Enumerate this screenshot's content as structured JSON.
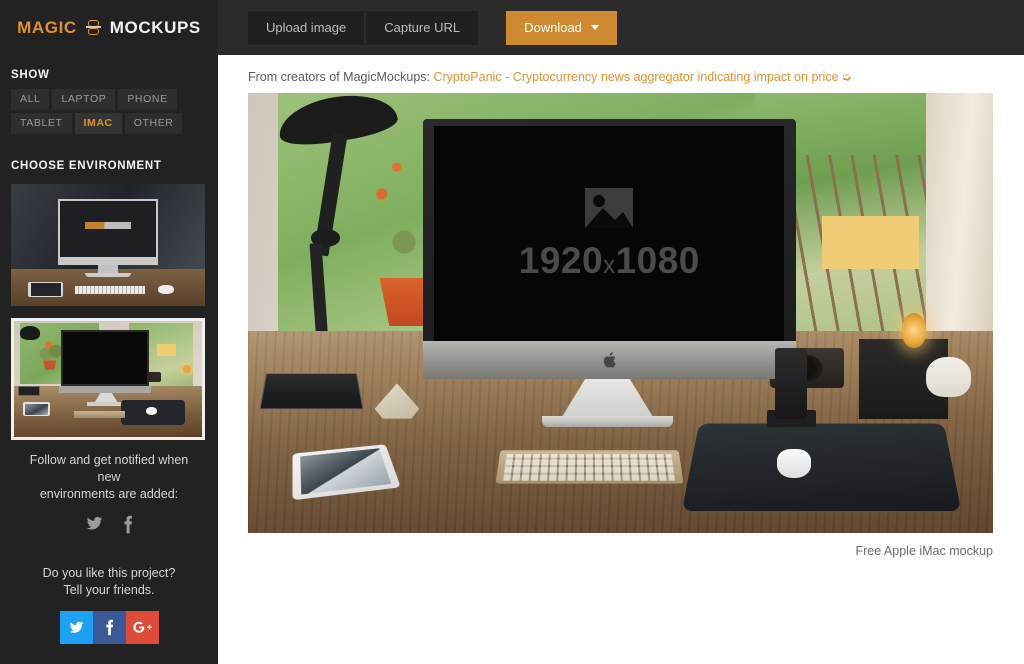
{
  "brand": {
    "name_first": "MAGIC",
    "name_second": "MOCKUPS",
    "mark_icon": "magic-mockups-mark-icon"
  },
  "toolbar": {
    "upload_label": "Upload image",
    "capture_label": "Capture URL",
    "download_label": "Download",
    "download_caret_icon": "chevron-down-icon",
    "accent_color": "#cd8a31"
  },
  "promo": {
    "prefix": "From creators of MagicMockups:",
    "link_text": "CryptoPanic - Cryptocurrency news aggregator indicating impact on price",
    "external_icon": "external-link-arrow-icon",
    "link_color": "#e0912f"
  },
  "sidebar": {
    "show": {
      "heading": "SHOW",
      "filters": [
        {
          "label": "ALL",
          "active": false
        },
        {
          "label": "LAPTOP",
          "active": false
        },
        {
          "label": "PHONE",
          "active": false
        },
        {
          "label": "TABLET",
          "active": false
        },
        {
          "label": "IMAC",
          "active": true
        },
        {
          "label": "OTHER",
          "active": false
        }
      ]
    },
    "environment": {
      "heading": "CHOOSE ENVIRONMENT",
      "items": [
        {
          "name": "dark-imac-desk-environment",
          "selected": false
        },
        {
          "name": "window-imac-desk-environment",
          "selected": true
        }
      ]
    },
    "follow": {
      "text_line1": "Follow and get notified when new",
      "text_line2": "environments are added:",
      "icons": [
        {
          "name": "twitter-icon",
          "label": "Twitter"
        },
        {
          "name": "facebook-icon",
          "label": "Facebook"
        }
      ]
    },
    "share": {
      "text_line1": "Do you like this project?",
      "text_line2": "Tell your friends.",
      "buttons": [
        {
          "name": "twitter-share-button",
          "label": "Twitter",
          "color": "#1DA1F2"
        },
        {
          "name": "facebook-share-button",
          "label": "Facebook",
          "color": "#3B5998"
        },
        {
          "name": "googleplus-share-button",
          "label": "Google Plus",
          "color": "#DD4B39"
        }
      ]
    }
  },
  "preview": {
    "placeholder": {
      "icon": "image-placeholder-icon",
      "resolution": "1920",
      "resolution_sep": "x",
      "resolution_h": "1080"
    },
    "caption": "Free Apple iMac mockup",
    "scene_name": "imac-on-wooden-desk-by-window"
  }
}
